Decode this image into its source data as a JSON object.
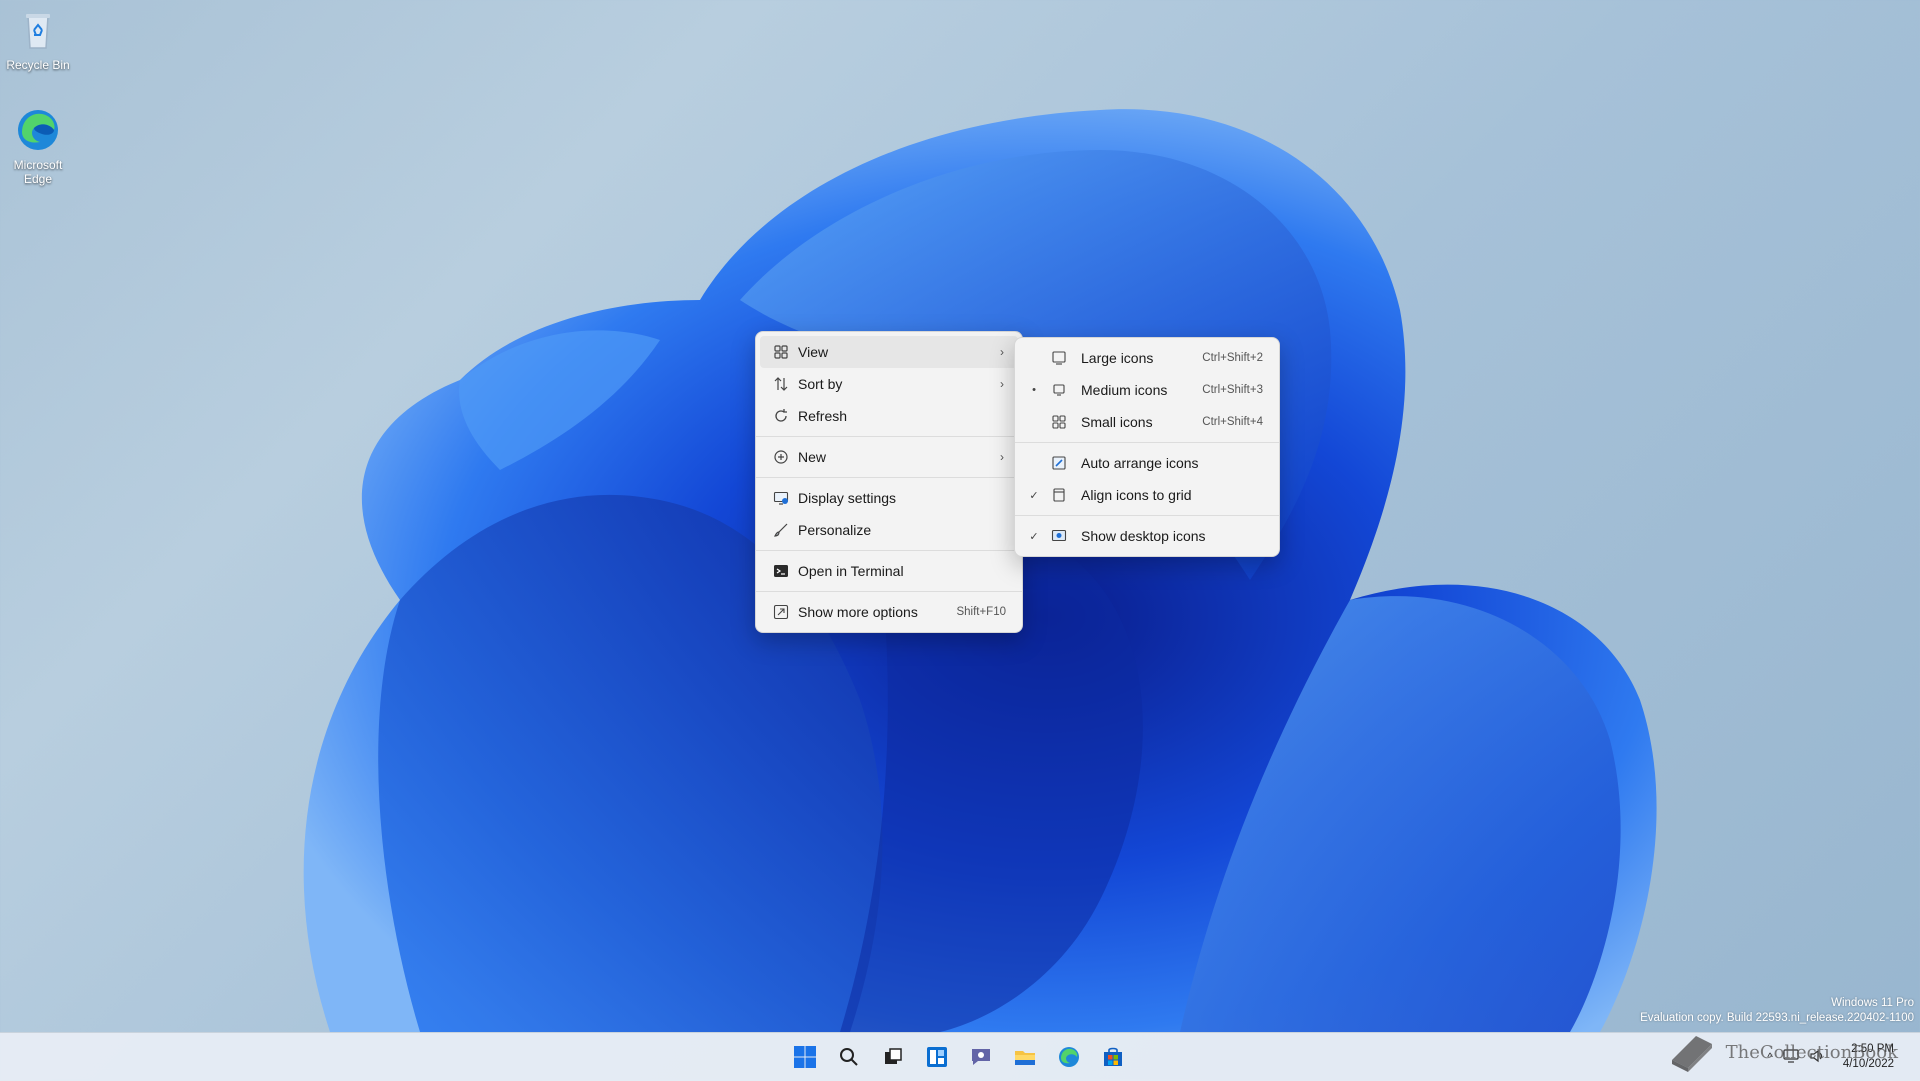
{
  "desktop": {
    "icons": [
      {
        "label": "Recycle Bin",
        "icon": "recycle-bin-icon"
      },
      {
        "label": "Microsoft Edge",
        "icon": "edge-icon"
      }
    ]
  },
  "context_menu": {
    "items": [
      {
        "label": "View",
        "icon": "grid-icon",
        "has_submenu": true
      },
      {
        "label": "Sort by",
        "icon": "sort-icon",
        "has_submenu": true
      },
      {
        "label": "Refresh",
        "icon": "refresh-icon"
      },
      {
        "label": "New",
        "icon": "plus-circle-icon",
        "has_submenu": true
      },
      {
        "label": "Display settings",
        "icon": "display-icon"
      },
      {
        "label": "Personalize",
        "icon": "brush-icon"
      },
      {
        "label": "Open in Terminal",
        "icon": "terminal-icon"
      },
      {
        "label": "Show more options",
        "icon": "more-options-icon",
        "shortcut": "Shift+F10"
      }
    ]
  },
  "view_submenu": {
    "items": [
      {
        "label": "Large icons",
        "shortcut": "Ctrl+Shift+2",
        "state": ""
      },
      {
        "label": "Medium icons",
        "shortcut": "Ctrl+Shift+3",
        "state": "•"
      },
      {
        "label": "Small icons",
        "shortcut": "Ctrl+Shift+4",
        "state": ""
      },
      {
        "label": "Auto arrange icons",
        "state": ""
      },
      {
        "label": "Align icons to grid",
        "state": "✓"
      },
      {
        "label": "Show desktop icons",
        "state": "✓"
      }
    ]
  },
  "watermark": {
    "line1": "Windows 11 Pro",
    "line2": "Evaluation copy. Build 22593.ni_release.220402-1100"
  },
  "taskbar": {
    "apps": [
      "start-icon",
      "search-icon",
      "task-view-icon",
      "widgets-icon",
      "chat-icon",
      "file-explorer-icon",
      "edge-icon",
      "store-icon"
    ],
    "time": "2:50 PM",
    "date": "4/10/2022"
  },
  "overlay_brand": "TheCollectionBook",
  "colors": {
    "accent": "#0a5bd9",
    "menu_bg": "#f3f3f3",
    "highlight": "#e6e6e6"
  }
}
